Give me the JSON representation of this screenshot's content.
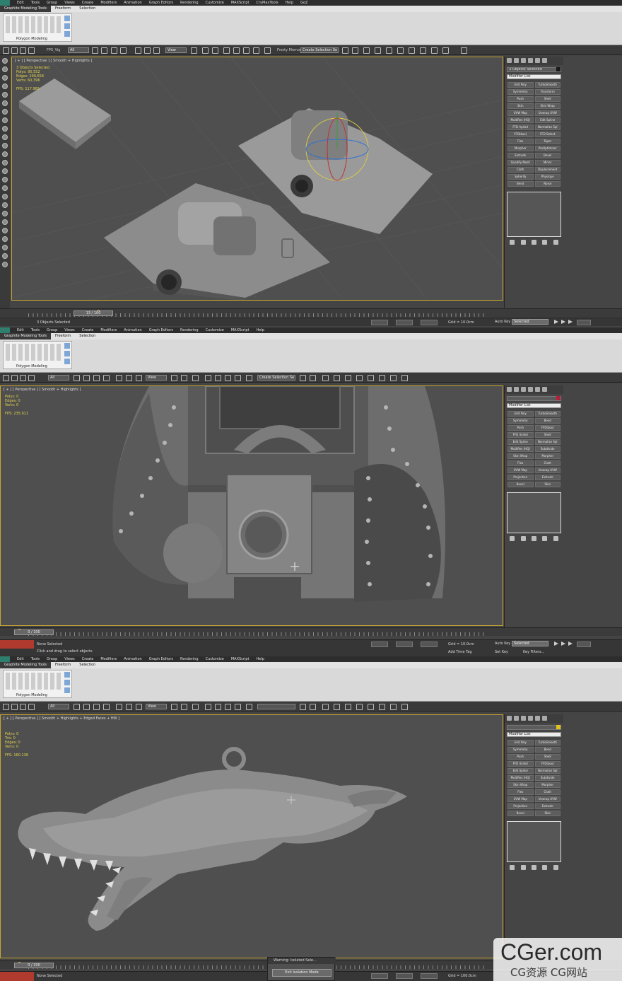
{
  "panels": [
    {
      "menu": [
        "Edit",
        "Tools",
        "Group",
        "Views",
        "Create",
        "Modifiers",
        "Animation",
        "Graph Editors",
        "Rendering",
        "Customize",
        "MAXScript",
        "CryMaxTools",
        "Help",
        "GoZ"
      ],
      "ribbon_tabs": [
        "Graphite Modeling Tools",
        "Freeform",
        "Selection"
      ],
      "ribbon_panel_label": "Polygon Modeling",
      "toolbar_texts": {
        "filter": "All",
        "view": "View",
        "memory": "Frosty Memory",
        "named": "Create Selection Se"
      },
      "viewport_label": "[ + ] [ Perspective ] [ Smooth + Highlights ]",
      "stats": [
        "3 Objects Selected",
        "Polys: 95,552",
        "Edges: 290,656",
        "Verts: 60,396",
        "",
        "FPS: 117.965"
      ],
      "cmd_name": "3 Objects Selected",
      "modifier_list": "Modifier List",
      "modifiers": [
        "Edit Poly",
        "TurboSmooth",
        "Symmetry",
        "Transform",
        "Push",
        "Shell",
        "Skin",
        "Skin Wrap",
        "UVW Map",
        "Unwrap UVW",
        "MultiRes (HQ)",
        "Edit Spline",
        "FFD Ap4x4",
        "Normalize Spl",
        "FFD(box)",
        "FFD Select",
        "Flex",
        "Taper",
        "Morpher",
        "ProOptimizer",
        "Extrude",
        "Bevel",
        "Quadify Mesh",
        "Mirror",
        "Cloth",
        "Displacement",
        "Spherify",
        "Physique",
        "Bend",
        "Noise"
      ],
      "timeline_slider": "13 / 100",
      "timeline_ticks": [
        "0",
        "10",
        "20",
        "30",
        "40",
        "50",
        "60",
        "70",
        "80",
        "90",
        "100"
      ],
      "status_text": "3 Objects Selected",
      "grid": "Grid = 10.0cm",
      "autokey": "Auto Key",
      "selected": "Selected",
      "setkey": "Set Key",
      "keyfilters": "Key Filters..."
    },
    {
      "menu": [
        "Edit",
        "Tools",
        "Group",
        "Views",
        "Create",
        "Modifiers",
        "Animation",
        "Graph Editors",
        "Rendering",
        "Customize",
        "MAXScript",
        "Help"
      ],
      "ribbon_tabs": [
        "Graphite Modeling Tools",
        "Freeform",
        "Selection"
      ],
      "ribbon_panel_label": "Polygon Modeling",
      "toolbar_texts": {
        "filter": "All",
        "view": "View",
        "named": "Create Selection Se"
      },
      "viewport_label": "[ + ] [ Perspective ] [ Smooth + Highlights ]",
      "stats": [
        "Polys: 0",
        "Edges: 0",
        "Verts: 0",
        "",
        "FPS: 235.911"
      ],
      "cmd_name": "",
      "modifier_list": "Modifier List",
      "modifiers": [
        "Edit Poly",
        "TurboSmooth",
        "Symmetry",
        "Bend",
        "Push",
        "FFD(box)",
        "FFD 4x4x4",
        "Shell",
        "Edit Spline",
        "Normalize Spl",
        "MultiRes (HQ)",
        "Subdivide",
        "Skin Wrap",
        "Morpher",
        "Flex",
        "Cloth",
        "UVW Map",
        "Unwrap UVW",
        "Projection",
        "Extrude",
        "Bevel",
        "Skin"
      ],
      "timeline_slider": "0 / 100",
      "timeline_ticks": [
        "0",
        "10",
        "20",
        "30",
        "40",
        "50",
        "60",
        "70",
        "80",
        "90",
        "100"
      ],
      "status_text": "None Selected",
      "prompt": "Click and drag to select objects",
      "grid": "Grid = 10.0cm",
      "addtime": "Add Time Tag",
      "autokey": "Auto Key",
      "selected": "Selected",
      "setkey": "Set Key",
      "keyfilters": "Key Filters..."
    },
    {
      "menu": [
        "Edit",
        "Tools",
        "Group",
        "Views",
        "Create",
        "Modifiers",
        "Animation",
        "Graph Editors",
        "Rendering",
        "Customize",
        "MAXScript",
        "Help"
      ],
      "ribbon_tabs": [
        "Graphite Modeling Tools",
        "Freeform",
        "Selection"
      ],
      "ribbon_panel_label": "Polygon Modeling",
      "toolbar_texts": {
        "filter": "All",
        "view": "View"
      },
      "viewport_label": "[ + ] [ Perspective ] [ Smooth + Highlights + Edged Faces + HW ]",
      "stats": [
        "Polys: 0",
        "Tris: 0",
        "Edges: 0",
        "Verts: 0",
        "",
        "FPS: 160.136"
      ],
      "cmd_name": "",
      "modifier_list": "Modifier List",
      "modifiers": [
        "Edit Poly",
        "TurboSmooth",
        "Symmetry",
        "Bend",
        "Push",
        "Shell",
        "FFD 4x4x4",
        "FFD(box)",
        "Edit Spline",
        "Normalize Spl",
        "MultiRes (HQ)",
        "Subdivide",
        "Skin Wrap",
        "Morpher",
        "Flex",
        "Cloth",
        "UVW Map",
        "Unwrap UVW",
        "Projection",
        "Extrude",
        "Bevel",
        "Skin"
      ],
      "timeline_slider": "0 / 100",
      "status_text": "None Selected",
      "grid": "Grid = 100.0cm",
      "warning_title": "Warning: Isolated Sele...",
      "warning_button": "Exit Isolation Mode"
    }
  ],
  "colors": {
    "accent": "#c7a531",
    "stats": "#e3d44a",
    "swatch1": "#1a1a1a",
    "swatch2": "#b0223a",
    "swatch3": "#e0c21f"
  },
  "watermark": {
    "main": "CGer.com",
    "sub": "CG资源 CG网站"
  }
}
